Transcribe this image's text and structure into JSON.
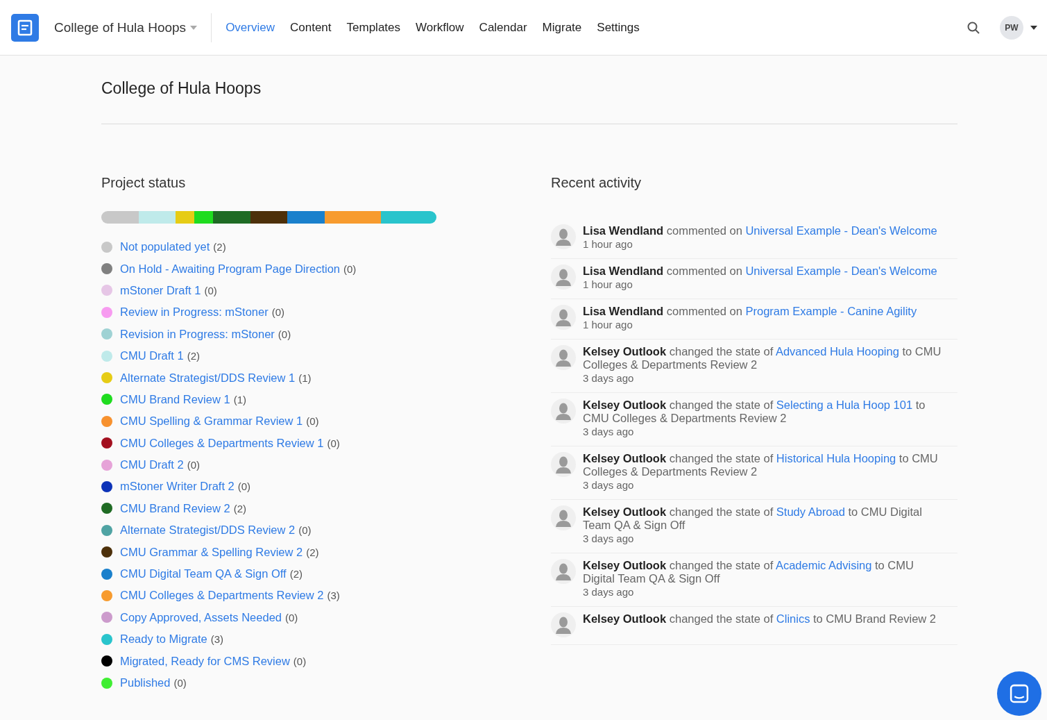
{
  "header": {
    "site": "College of Hula Hoops",
    "nav": [
      {
        "label": "Overview",
        "selected": true
      },
      {
        "label": "Content",
        "selected": false
      },
      {
        "label": "Templates",
        "selected": false
      },
      {
        "label": "Workflow",
        "selected": false
      },
      {
        "label": "Calendar",
        "selected": false
      },
      {
        "label": "Migrate",
        "selected": false
      },
      {
        "label": "Settings",
        "selected": false
      }
    ],
    "user_initials": "PW"
  },
  "page_title": "College of Hula Hoops",
  "project_status": {
    "title": "Project status",
    "statuses": [
      {
        "name": "Not populated yet",
        "count": "(2)",
        "color": "#c8c8c8"
      },
      {
        "name": "On Hold - Awaiting Program Page Direction",
        "count": "(0)",
        "color": "#808080"
      },
      {
        "name": "mStoner Draft 1",
        "count": "(0)",
        "color": "#e6c6e6"
      },
      {
        "name": "Review in Progress: mStoner",
        "count": "(0)",
        "color": "#f79bf0"
      },
      {
        "name": "Revision in Progress: mStoner",
        "count": "(0)",
        "color": "#9fd2d4"
      },
      {
        "name": "CMU Draft 1",
        "count": "(2)",
        "color": "#bfeaea"
      },
      {
        "name": "Alternate Strategist/DDS Review 1",
        "count": "(1)",
        "color": "#e6cc15"
      },
      {
        "name": "CMU Brand Review 1",
        "count": "(1)",
        "color": "#1fdc1f"
      },
      {
        "name": "CMU Spelling & Grammar Review 1",
        "count": "(0)",
        "color": "#f7912e"
      },
      {
        "name": "CMU Colleges & Departments Review 1",
        "count": "(0)",
        "color": "#a3101f"
      },
      {
        "name": "CMU Draft 2",
        "count": "(0)",
        "color": "#e6a3d8"
      },
      {
        "name": "mStoner Writer Draft 2",
        "count": "(0)",
        "color": "#0d33b8"
      },
      {
        "name": "CMU Brand Review 2",
        "count": "(2)",
        "color": "#1f6b24"
      },
      {
        "name": "Alternate Strategist/DDS Review 2",
        "count": "(0)",
        "color": "#4fa3a3"
      },
      {
        "name": "CMU Grammar & Spelling Review 2",
        "count": "(2)",
        "color": "#4d300a"
      },
      {
        "name": "CMU Digital Team QA & Sign Off",
        "count": "(2)",
        "color": "#1a80cc"
      },
      {
        "name": "CMU Colleges & Departments Review 2",
        "count": "(3)",
        "color": "#f79b2e"
      },
      {
        "name": "Copy Approved, Assets Needed",
        "count": "(0)",
        "color": "#cc9bcc"
      },
      {
        "name": "Ready to Migrate",
        "count": "(3)",
        "color": "#29c4cc"
      },
      {
        "name": "Migrated, Ready for CMS Review",
        "count": "(0)",
        "color": "#000000"
      },
      {
        "name": "Published",
        "count": "(0)",
        "color": "#40ee33"
      }
    ]
  },
  "recent_activity": {
    "title": "Recent activity",
    "items": [
      {
        "actor": "Lisa Wendland",
        "action": "commented on",
        "link": "Universal Example - Dean's Welcome",
        "time": "1 hour ago"
      },
      {
        "actor": "Lisa Wendland",
        "action": "commented on",
        "link": "Universal Example - Dean's Welcome",
        "time": "1 hour ago"
      },
      {
        "actor": "Lisa Wendland",
        "action": "commented on",
        "link": "Program Example - Canine Agility",
        "time": "1 hour ago"
      },
      {
        "actor": "Kelsey Outlook",
        "action": "changed the state of",
        "link": "Advanced Hula Hooping",
        "after": "to CMU Colleges & Departments Review 2",
        "time": "3 days ago"
      },
      {
        "actor": "Kelsey Outlook",
        "action": "changed the state of",
        "link": "Selecting a Hula Hoop 101",
        "after": "to CMU Colleges & Departments Review 2",
        "time": "3 days ago"
      },
      {
        "actor": "Kelsey Outlook",
        "action": "changed the state of",
        "link": "Historical Hula Hooping",
        "after": "to CMU Colleges & Departments Review 2",
        "time": "3 days ago"
      },
      {
        "actor": "Kelsey Outlook",
        "action": "changed the state of",
        "link": "Study Abroad",
        "after": "to CMU Digital Team QA & Sign Off",
        "time": "3 days ago"
      },
      {
        "actor": "Kelsey Outlook",
        "action": "changed the state of",
        "link": "Academic Advising",
        "after": "to CMU Digital Team QA & Sign Off",
        "time": "3 days ago"
      },
      {
        "actor": "Kelsey Outlook",
        "action": "changed the state of",
        "link": "Clinics",
        "after": "to CMU Brand Review 2"
      }
    ]
  }
}
